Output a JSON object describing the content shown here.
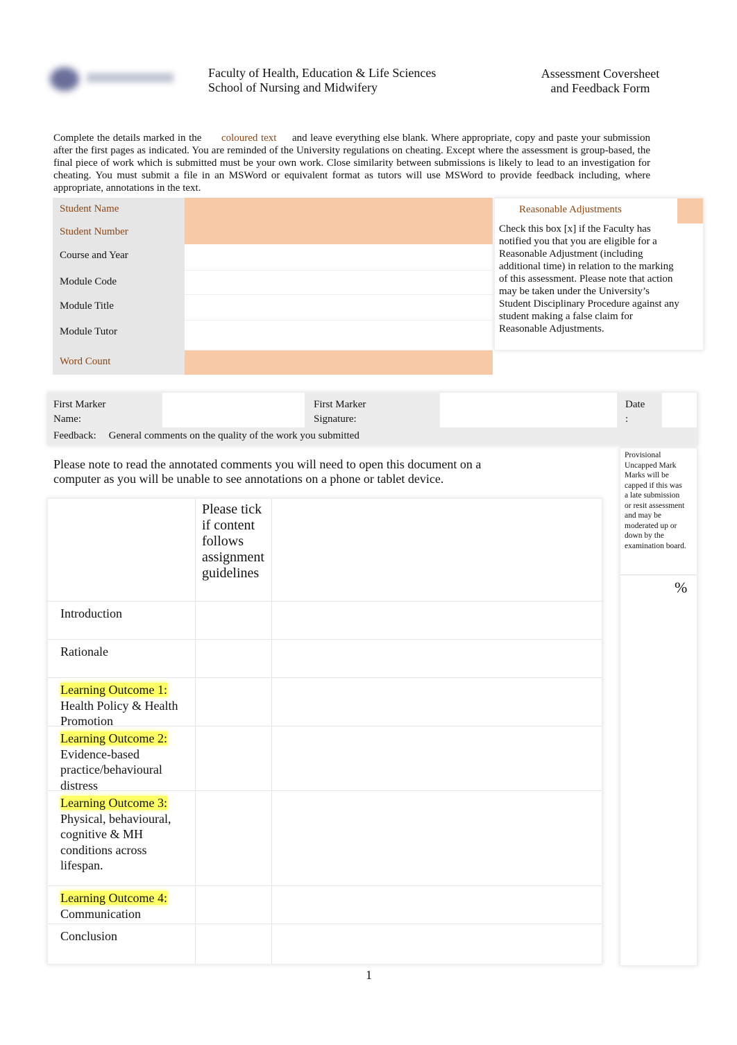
{
  "header": {
    "logo": "University logo",
    "faculty": "Faculty of Health, Education & Life Sciences",
    "school": "School of Nursing and Midwifery",
    "form_title_1": "Assessment Coversheet",
    "form_title_2": "and Feedback Form"
  },
  "intro": {
    "part1": "Complete the details marked in the",
    "coloured": "coloured text",
    "part2": "and leave everything else blank. Where appropriate, copy and paste your submission after the first pages as indicated. You are reminded of the University regulations on cheating. Except where the assessment is group-based, the final piece of work which is submitted must be your own work. Close similarity between submissions is likely to lead to an investigation for cheating. You must submit a file in an MSWord or equivalent format as tutors will use MSWord to provide feedback including, where appropriate, annotations in the text."
  },
  "fields": [
    {
      "label": "Student Name",
      "required": true
    },
    {
      "label": "Student Number",
      "required": true
    },
    {
      "label": "Course and Year",
      "required": false
    },
    {
      "label": "Module Code",
      "required": false
    },
    {
      "label": "Module Title",
      "required": false
    },
    {
      "label": "Module Tutor",
      "required": false
    },
    {
      "label": "Word Count",
      "required": true
    }
  ],
  "reasonable": {
    "title": "Reasonable Adjustments",
    "text": "Check this box [x] if the Faculty has notified you that you are eligible for a Reasonable Adjustment (including additional time) in relation to the marking of this assessment. Please note that action may be taken under the University’s Student Disciplinary Procedure against any student making a false claim for Reasonable Adjustments."
  },
  "marker": {
    "name_label_1": "First Marker",
    "name_label_2": "Name:",
    "sig_label_1": "First Marker",
    "sig_label_2": "Signature:",
    "date_label_1": "Date",
    "date_label_2": ":",
    "feedback_label": "Feedback:",
    "feedback_desc": "General comments on the quality of the work you submitted"
  },
  "note": "Please note to read the annotated comments you will need to open this document on a computer as you will be unable to see annotations on a phone or tablet device.",
  "mark": {
    "text": "Provisional Uncapped Mark Marks will be capped if this was a late submission or resit assessment and may be moderated up or down by the examination board.",
    "percent": "%"
  },
  "table": {
    "tick_header": "Please tick if content follows assignment guidelines",
    "rows": [
      {
        "highlight": "",
        "label": "Introduction"
      },
      {
        "highlight": "",
        "label": "Rationale"
      },
      {
        "highlight": "Learning Outcome 1:",
        "label": "Health Policy & Health Promotion"
      },
      {
        "highlight": "Learning Outcome 2:",
        "label": "Evidence-based practice/behavioural distress"
      },
      {
        "highlight": "Learning Outcome 3:",
        "label": "Physical, behavioural, cognitive & MH conditions across lifespan."
      },
      {
        "highlight": "Learning Outcome 4:",
        "label": "Communication"
      },
      {
        "highlight": "",
        "label": "Conclusion"
      }
    ]
  },
  "footer": {
    "page_number": "1"
  },
  "colors": {
    "required_fill": "#f7c9a6",
    "required_text": "#8b4513",
    "highlight": "#ffff66"
  }
}
